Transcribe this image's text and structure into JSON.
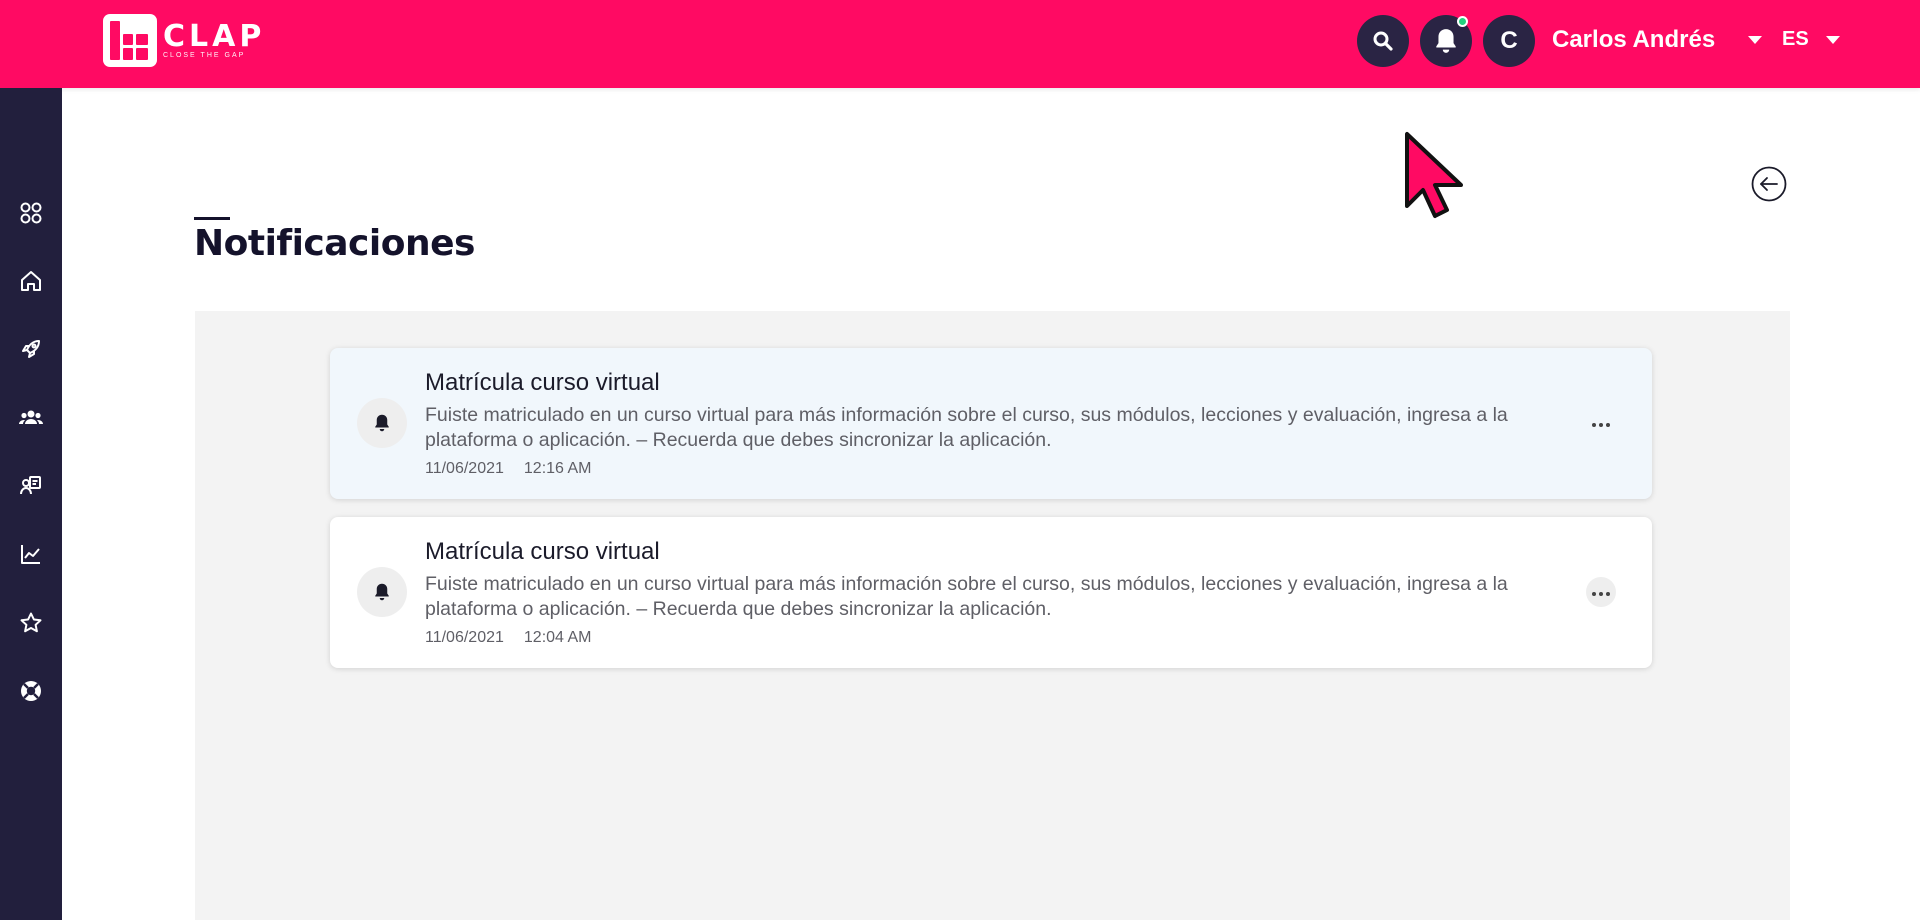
{
  "brand": {
    "name": "CLAP",
    "tagline": "CLOSE THE GAP",
    "primary_color": "#ff0a63",
    "dark_color": "#221f3d"
  },
  "header": {
    "search_icon": "search-icon",
    "notifications_icon": "bell-icon",
    "has_new_notifications": true,
    "avatar_initial": "C",
    "user_name": "Carlos Andrés",
    "language": "ES"
  },
  "sidebar": {
    "items": [
      {
        "icon": "grid-icon"
      },
      {
        "icon": "home-icon"
      },
      {
        "icon": "rocket-icon"
      },
      {
        "icon": "users-icon"
      },
      {
        "icon": "teacher-icon"
      },
      {
        "icon": "chart-icon"
      },
      {
        "icon": "star-icon"
      },
      {
        "icon": "lifebuoy-icon"
      }
    ]
  },
  "page": {
    "title": "Notificaciones",
    "back_icon": "arrow-left-icon"
  },
  "notifications": [
    {
      "title": "Matrícula curso virtual",
      "body": "Fuiste matriculado en un curso virtual para más información sobre el curso, sus módulos, lecciones y evaluación, ingresa a la plataforma o aplicación. – Recuerda que debes sincronizar la aplicación.",
      "date": "11/06/2021",
      "time": "12:16 AM",
      "unread": true
    },
    {
      "title": "Matrícula curso virtual",
      "body": "Fuiste matriculado en un curso virtual para más información sobre el curso, sus módulos, lecciones y evaluación, ingresa a la plataforma o aplicación. – Recuerda que debes sincronizar la aplicación.",
      "date": "11/06/2021",
      "time": "12:04 AM",
      "unread": false
    }
  ]
}
